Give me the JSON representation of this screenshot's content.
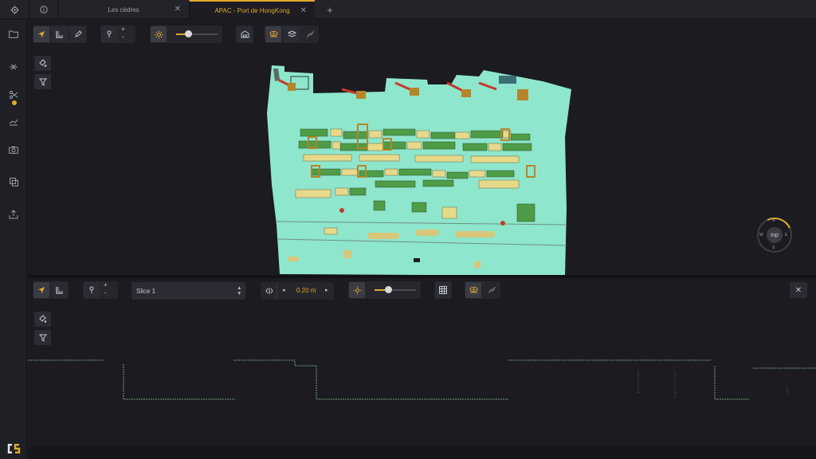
{
  "tabs": {
    "items": [
      {
        "label": "Les cèdres",
        "active": false
      },
      {
        "label": "APAC - Port de HongKong",
        "active": true
      }
    ],
    "close_glyph": "✕",
    "add_glyph": "+"
  },
  "sidebar": {
    "icons": [
      "folder-icon",
      "filter-plane-icon",
      "scissors-icon",
      "layers-chart-icon",
      "camera-icon",
      "copy-icon",
      "export-icon"
    ],
    "logo": {
      "letters": "CS"
    }
  },
  "top_toolbar": {
    "plus_label": "+",
    "minus_label": "-"
  },
  "bottom_toolbar": {
    "plus_label": "+",
    "minus_label": "-",
    "slice_select": {
      "value": "Slice 1"
    },
    "thickness": {
      "value": "0.20 m",
      "left_arrow": "◂",
      "right_arrow": "▸"
    },
    "close_glyph": "✕"
  },
  "compass": {
    "label": "top",
    "n": "N",
    "s": "S",
    "e": "E",
    "w": "W"
  },
  "colors": {
    "accent": "#e0a92a",
    "cloud": "#8ee6cc",
    "containers_green": "#4f9c46",
    "containers_yellow": "#e7d98a",
    "cranes": "#c23b2c"
  }
}
